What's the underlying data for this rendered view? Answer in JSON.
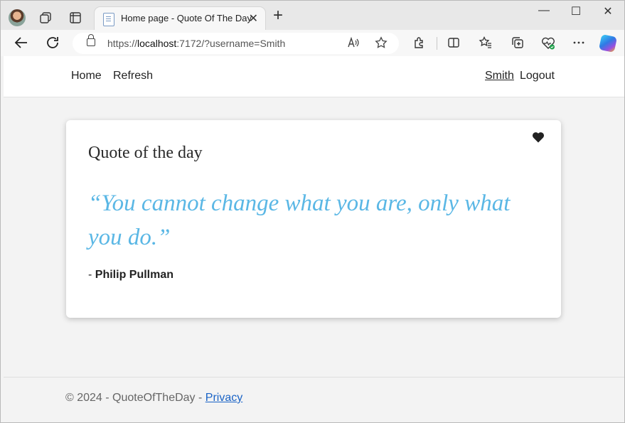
{
  "browser": {
    "tab_title": "Home page - Quote Of The Day",
    "tab_close": "✕",
    "new_tab": "+",
    "url_prefix": "https://",
    "url_host": "localhost",
    "url_rest": ":7172/?username=Smith",
    "window_controls": {
      "minimize": "—",
      "maximize": "☐",
      "close": "✕"
    }
  },
  "navbar": {
    "home": "Home",
    "refresh": "Refresh",
    "username": "Smith",
    "logout": "Logout"
  },
  "card": {
    "title": "Quote of the day",
    "quote": "“You cannot change what you are, only what you do.”",
    "author_prefix": "- ",
    "author": "Philip Pullman"
  },
  "footer": {
    "text": "© 2024 - QuoteOfTheDay - ",
    "privacy": "Privacy"
  },
  "colors": {
    "quote": "#5ab7e5",
    "link": "#1a63c6"
  }
}
